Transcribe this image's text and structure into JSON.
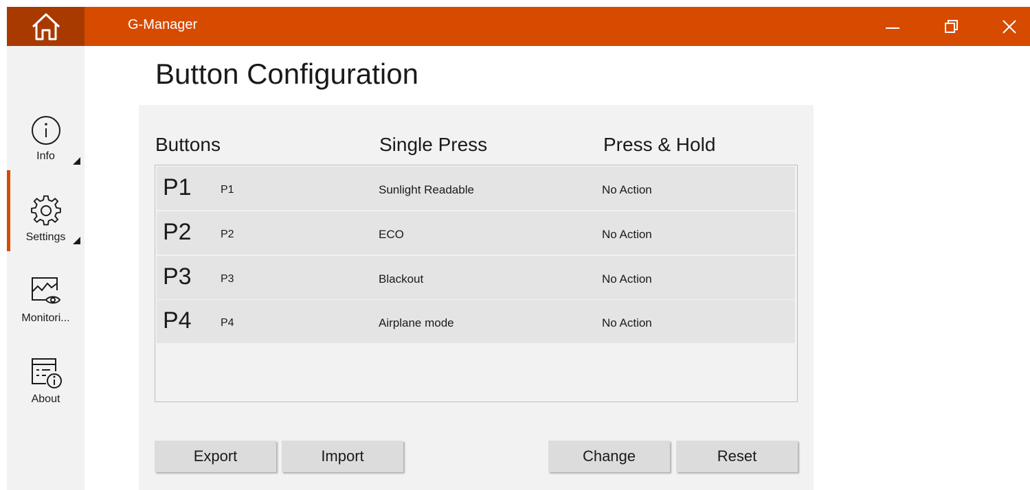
{
  "window": {
    "title": "G-Manager",
    "accent_color": "#d64b00",
    "home_icon": "home-icon",
    "minimize_icon": "minimize-icon",
    "restore_icon": "restore-icon",
    "close_icon": "close-icon"
  },
  "nav": {
    "items": [
      {
        "label": "Info",
        "icon": "info-icon"
      },
      {
        "label": "Settings",
        "icon": "gear-icon"
      },
      {
        "label": "Monitori...",
        "icon": "monitoring-icon"
      },
      {
        "label": "About",
        "icon": "about-icon"
      }
    ]
  },
  "page": {
    "title": "Button Configuration"
  },
  "table": {
    "headers": {
      "buttons": "Buttons",
      "single": "Single Press",
      "hold": "Press & Hold"
    },
    "rows": [
      {
        "big": "P1",
        "small": "P1",
        "single": "Sunlight Readable",
        "hold": "No Action"
      },
      {
        "big": "P2",
        "small": "P2",
        "single": "ECO",
        "hold": "No Action"
      },
      {
        "big": "P3",
        "small": "P3",
        "single": "Blackout",
        "hold": "No Action"
      },
      {
        "big": "P4",
        "small": "P4",
        "single": "Airplane mode",
        "hold": "No Action"
      }
    ]
  },
  "actions": {
    "export": "Export",
    "import": "Import",
    "change": "Change",
    "reset": "Reset"
  }
}
